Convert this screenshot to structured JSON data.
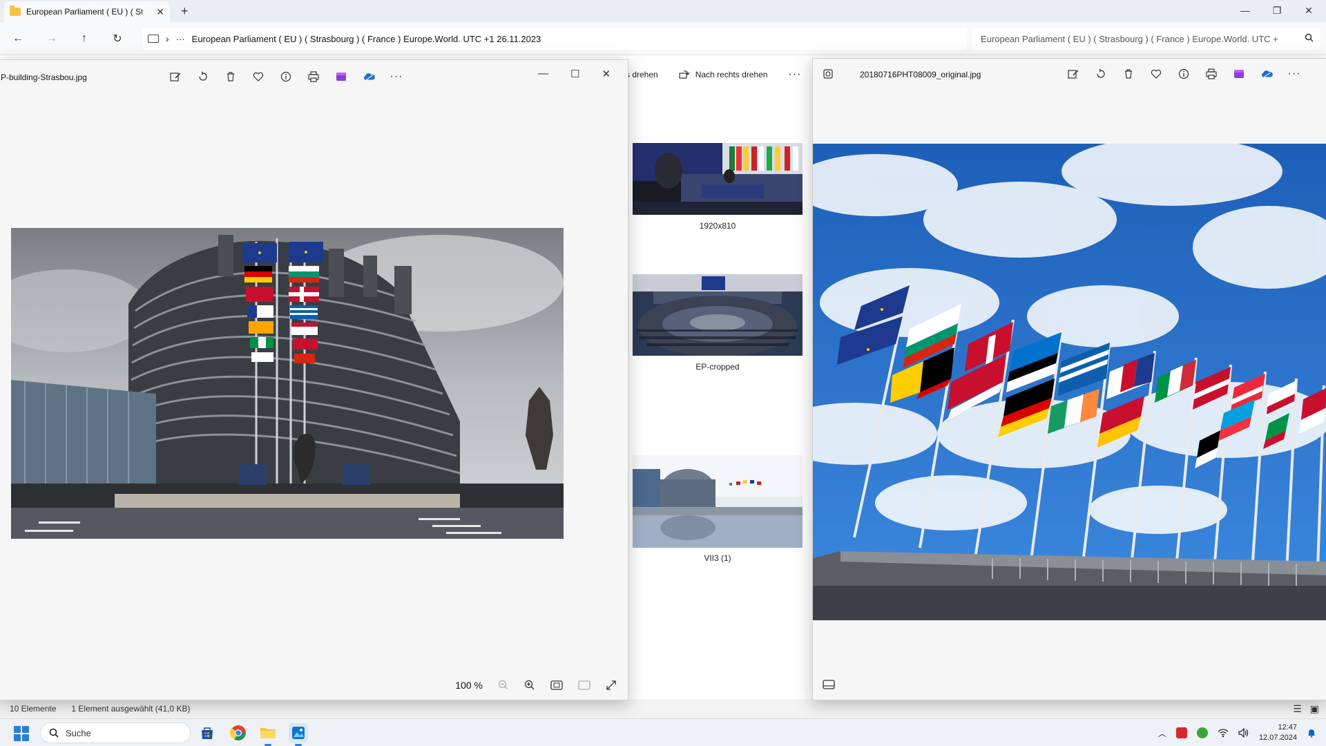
{
  "explorer": {
    "tab_title": "European Parliament ( EU ) ( St",
    "tab_close": "✕",
    "tab_new": "+",
    "window_controls": {
      "minimize": "—",
      "restore": "❐",
      "close": "✕"
    },
    "nav": {
      "back": "←",
      "forward": "→",
      "up": "↑",
      "refresh": "↻",
      "chevron": "›",
      "more": "···"
    },
    "address": "European Parliament ( EU ) ( Strasbourg ) ( France ) Europe.World. UTC +1 26.11.2023",
    "search_placeholder": "European Parliament ( EU ) ( Strasbourg ) ( France ) Europe.World. UTC +",
    "cmdbar": {
      "rotate_left_partial": "s drehen",
      "rotate_right": "Nach rechts drehen",
      "more": "···"
    },
    "thumbnails": [
      {
        "label": "1920x810"
      },
      {
        "label": "EP-cropped"
      },
      {
        "label": "VII3 (1)"
      }
    ],
    "status": {
      "count": "10 Elemente",
      "selection": "1 Element ausgewählt (41,0 KB)"
    }
  },
  "viewer_left": {
    "filename": "P-building-Strasbou.jpg",
    "zoom": "100 %",
    "tools": [
      "edit-icon",
      "rotate-icon",
      "delete-icon",
      "favorite-icon",
      "info-icon",
      "print-icon",
      "clipchamp-icon",
      "onedrive-icon",
      "more-icon"
    ],
    "window_controls": {
      "minimize": "—",
      "maximize": "☐",
      "close": "✕"
    }
  },
  "viewer_right": {
    "filename": "20180716PHT08009_original.jpg"
  },
  "taskbar": {
    "search_label": "Suche",
    "time": "12:47",
    "date": "12.07.2024"
  },
  "colors": {
    "accent": "#2a7fd4",
    "explorer_bg": "#ffffff",
    "viewer_bg": "#f6f6f6"
  }
}
